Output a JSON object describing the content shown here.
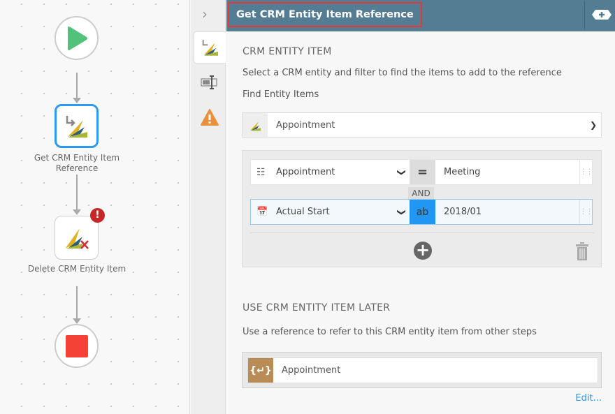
{
  "canvas": {
    "nodes": [
      {
        "label": "Get CRM Entity Item Reference"
      },
      {
        "label": "Delete CRM Entity Item"
      }
    ]
  },
  "header": {
    "title": "Get CRM Entity Item Reference"
  },
  "section1": {
    "heading": "CRM ENTITY ITEM",
    "description": "Select a CRM entity and filter to find the items to add to the reference",
    "find_label": "Find Entity Items",
    "entity_value": "Appointment"
  },
  "filters": {
    "rows": [
      {
        "field": "Appointment",
        "operator": "=",
        "value": "Meeting"
      },
      {
        "field": "Actual Start",
        "operator": "ab",
        "value": "2018/01"
      }
    ],
    "conjunction": "AND"
  },
  "section2": {
    "heading": "USE CRM ENTITY ITEM LATER",
    "description": "Use a reference to refer to this CRM entity item from other steps",
    "reference_value": "Appointment",
    "edit_label": "Edit..."
  },
  "colors": {
    "header": "#547c93",
    "accent": "#2196f3",
    "start": "#52c27a",
    "stop": "#f44336",
    "warning": "#e8913a",
    "error": "#c62828"
  }
}
